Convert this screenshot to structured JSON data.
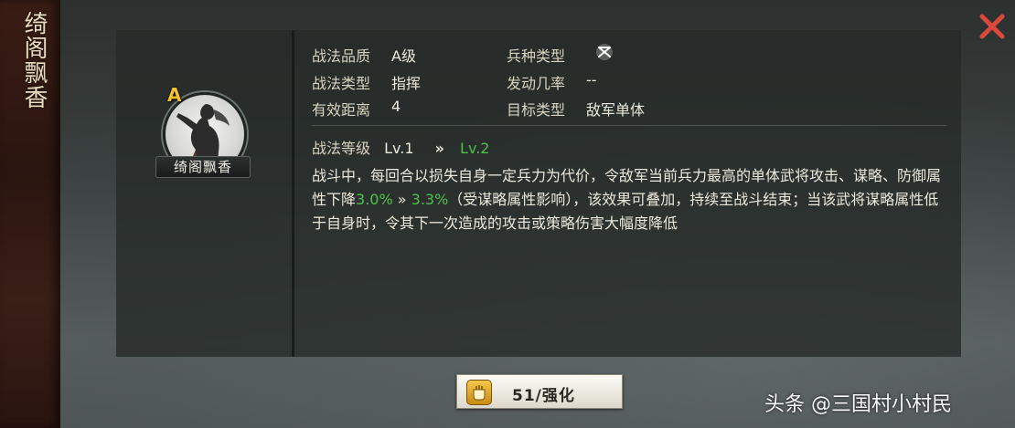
{
  "tactic": {
    "vertical_title": "绮阁飘香",
    "name_plate": "绮阁飘香",
    "grade_badge": "A"
  },
  "info": {
    "quality_label": "战法品质",
    "quality_value": "A级",
    "troop_label": "兵种类型",
    "type_label": "战法类型",
    "type_value": "指挥",
    "rate_label": "发动几率",
    "rate_value": "--",
    "range_label": "有效距离",
    "range_value": "4",
    "target_label": "目标类型",
    "target_value": "敌军单体"
  },
  "level": {
    "label": "战法等级",
    "current": "Lv.1",
    "arrow": "»",
    "next": "Lv.2"
  },
  "description": {
    "part1": "战斗中，每回合以损失自身一定兵力为代价，令敌军当前兵力最高的单体武将攻击、谋略、防御属性下降",
    "old_value": "3.0%",
    "arrow": " » ",
    "new_value": "3.3%",
    "part2": "（受谋略属性影响），该效果可叠加，持续至战斗结束；当该武将谋略属性低于自身时，令其下一次造成的攻击或策略伤害大幅度降低"
  },
  "upgrade_button": {
    "label": "51/强化"
  },
  "watermark": "头条 @三国村小村民",
  "colors": {
    "green": "#4fc04a",
    "grade": "#f2c230",
    "close": "#d94a3c"
  }
}
